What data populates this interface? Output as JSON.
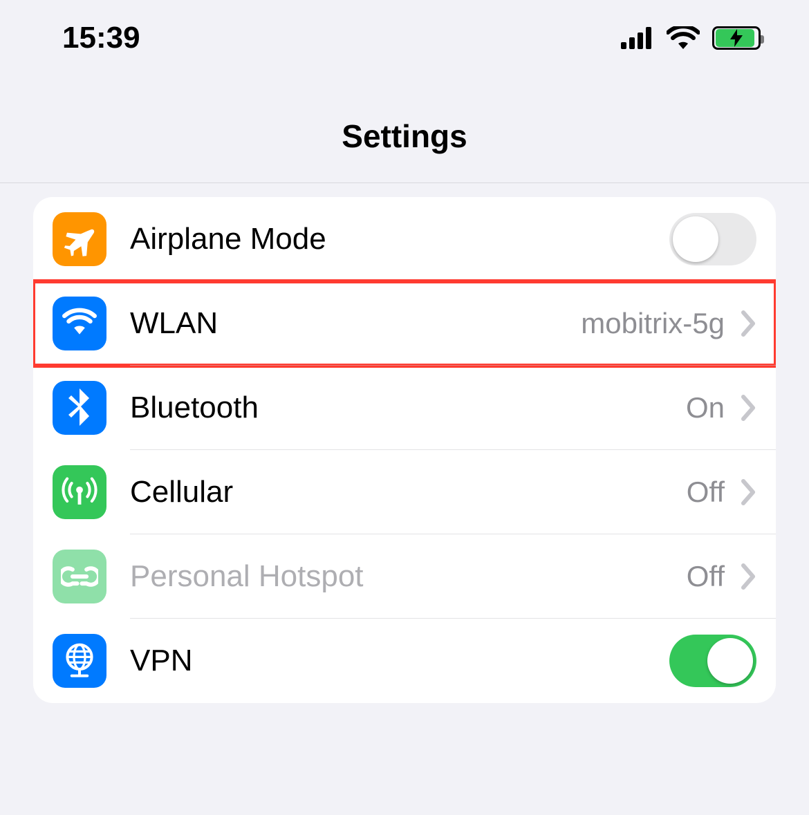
{
  "status": {
    "time": "15:39",
    "signal_bars": 4,
    "wifi_bars": 3,
    "battery_pct": 85,
    "battery_charging": true
  },
  "header": {
    "title": "Settings"
  },
  "colors": {
    "orange": "#ff9500",
    "blue": "#007aff",
    "green": "#34c759",
    "green_faded": "#8fe0a9",
    "highlight": "#ff3b30"
  },
  "settings": {
    "airplane": {
      "label": "Airplane Mode",
      "icon": "airplane-icon",
      "toggle": false
    },
    "wlan": {
      "label": "WLAN",
      "icon": "wifi-icon",
      "detail": "mobitrix-5g",
      "highlighted": true
    },
    "bluetooth": {
      "label": "Bluetooth",
      "icon": "bluetooth-icon",
      "detail": "On"
    },
    "cellular": {
      "label": "Cellular",
      "icon": "cellular-icon",
      "detail": "Off"
    },
    "hotspot": {
      "label": "Personal Hotspot",
      "icon": "link-icon",
      "detail": "Off",
      "disabled": true
    },
    "vpn": {
      "label": "VPN",
      "icon": "globe-icon",
      "toggle": true
    }
  }
}
